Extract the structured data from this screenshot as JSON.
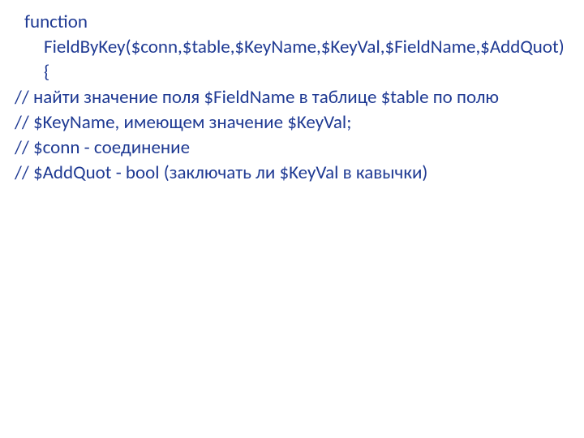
{
  "lines": {
    "l1": "function FieldByKey($conn,$table,$KeyName,$KeyVal,$FieldName,$AddQuot){",
    "l2": "// найти значение поля $FieldName в таблице $table по полю",
    "l3": "// $KeyName,  имеющем значение $KeyVal;",
    "l4": "// $conn - соединение",
    "l5": "// $AddQuot - bool (заключать ли $KeyVal в кавычки)"
  }
}
